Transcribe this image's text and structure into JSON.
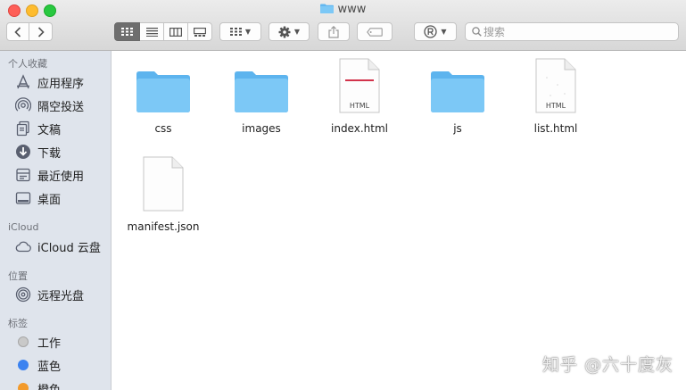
{
  "window": {
    "title": "www",
    "search_placeholder": "搜索"
  },
  "toolbar": {
    "nav": [
      "back",
      "forward"
    ],
    "view_modes": [
      "icon-view",
      "list-view",
      "column-view",
      "gallery-view"
    ],
    "active_view": "icon-view"
  },
  "sidebar": {
    "favorites": {
      "title": "个人收藏",
      "items": [
        {
          "label": "应用程序",
          "icon": "applications-icon"
        },
        {
          "label": "隔空投送",
          "icon": "airdrop-icon"
        },
        {
          "label": "文稿",
          "icon": "documents-icon"
        },
        {
          "label": "下载",
          "icon": "downloads-icon"
        },
        {
          "label": "最近使用",
          "icon": "recents-icon"
        },
        {
          "label": "桌面",
          "icon": "desktop-icon"
        }
      ]
    },
    "icloud": {
      "title": "iCloud",
      "items": [
        {
          "label": "iCloud 云盘",
          "icon": "cloud-icon"
        }
      ]
    },
    "locations": {
      "title": "位置",
      "items": [
        {
          "label": "远程光盘",
          "icon": "disc-icon"
        }
      ]
    },
    "tags": {
      "title": "标签",
      "items": [
        {
          "label": "工作",
          "color": "#c9c9c9"
        },
        {
          "label": "蓝色",
          "color": "#3b82f0"
        },
        {
          "label": "橙色",
          "color": "#f39a2b"
        }
      ]
    }
  },
  "files": [
    {
      "name": "css",
      "type": "folder"
    },
    {
      "name": "images",
      "type": "folder"
    },
    {
      "name": "index.html",
      "type": "html",
      "badge": "HTML"
    },
    {
      "name": "js",
      "type": "folder"
    },
    {
      "name": "list.html",
      "type": "html",
      "badge": "HTML"
    },
    {
      "name": "manifest.json",
      "type": "document"
    }
  ],
  "watermark": "知乎 @六十度灰",
  "colors": {
    "folder": "#6fc0f3",
    "sidebar_bg": "#dfe4ec",
    "active_segment": "#6e6e6e"
  }
}
